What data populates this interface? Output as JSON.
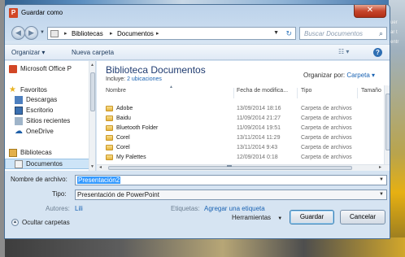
{
  "window": {
    "title": "Guardar como",
    "close_glyph": "✕",
    "app_icon": "powerpoint-icon"
  },
  "navigation": {
    "back_glyph": "◀",
    "forward_glyph": "▶",
    "address_crumbs": [
      "Bibliotecas",
      "Documentos"
    ],
    "search_placeholder": "Buscar Documentos"
  },
  "toolbar": {
    "organize_label": "Organizar ▾",
    "new_folder_label": "Nueva carpeta",
    "views_glyph": "☷ ▾",
    "help_glyph": "?"
  },
  "nav_pane": {
    "items": [
      {
        "label": "Microsoft Office P",
        "icon": "powerpoint-icon"
      },
      {
        "label": "Favoritos",
        "icon": "star-icon"
      },
      {
        "label": "Descargas",
        "icon": "downloads-icon"
      },
      {
        "label": "Escritorio",
        "icon": "desktop-icon"
      },
      {
        "label": "Sitios recientes",
        "icon": "recent-places-icon"
      },
      {
        "label": "OneDrive",
        "icon": "onedrive-icon"
      },
      {
        "label": "Bibliotecas",
        "icon": "libraries-icon"
      },
      {
        "label": "Documentos",
        "icon": "documents-icon",
        "selected": true
      }
    ]
  },
  "library": {
    "title": "Biblioteca Documentos",
    "includes_prefix": "Incluye:",
    "includes_link": "2 ubicaciones",
    "arrange_label": "Organizar por:",
    "arrange_value": "Carpeta ▾"
  },
  "file_list": {
    "columns": [
      "Nombre",
      "Fecha de modifica...",
      "Tipo",
      "Tamaño"
    ],
    "rows": [
      {
        "name": "Adobe",
        "date": "13/09/2014 18:16",
        "type": "Carpeta de archivos"
      },
      {
        "name": "Baidu",
        "date": "11/09/2014 21:27",
        "type": "Carpeta de archivos"
      },
      {
        "name": "Bluetooth Folder",
        "date": "11/09/2014 19:51",
        "type": "Carpeta de archivos"
      },
      {
        "name": "Corel",
        "date": "13/11/2014 11:29",
        "type": "Carpeta de archivos"
      },
      {
        "name": "Corel",
        "date": "13/11/2014 9:43",
        "type": "Carpeta de archivos"
      },
      {
        "name": "My Palettes",
        "date": "12/09/2014 0:18",
        "type": "Carpeta de archivos"
      }
    ]
  },
  "form": {
    "filename_label": "Nombre de archivo:",
    "filename_value": "Presentación2",
    "type_label": "Tipo:",
    "type_value": "Presentación de PowerPoint",
    "authors_label": "Autores:",
    "authors_value": "Lili",
    "tags_label": "Etiquetas:",
    "tags_link": "Agregar una etiqueta"
  },
  "footer": {
    "hide_folders_label": "Ocultar carpetas",
    "tools_label": "Herramientas",
    "save_label": "Guardar",
    "cancel_label": "Cancelar"
  },
  "background": {
    "right_edge_text": [
      "uer",
      "ar t",
      "entr"
    ]
  },
  "colors": {
    "accent_link": "#1a63b3",
    "selection": "#3399ff",
    "close_button": "#c7462d",
    "library_title": "#1f3b70"
  }
}
